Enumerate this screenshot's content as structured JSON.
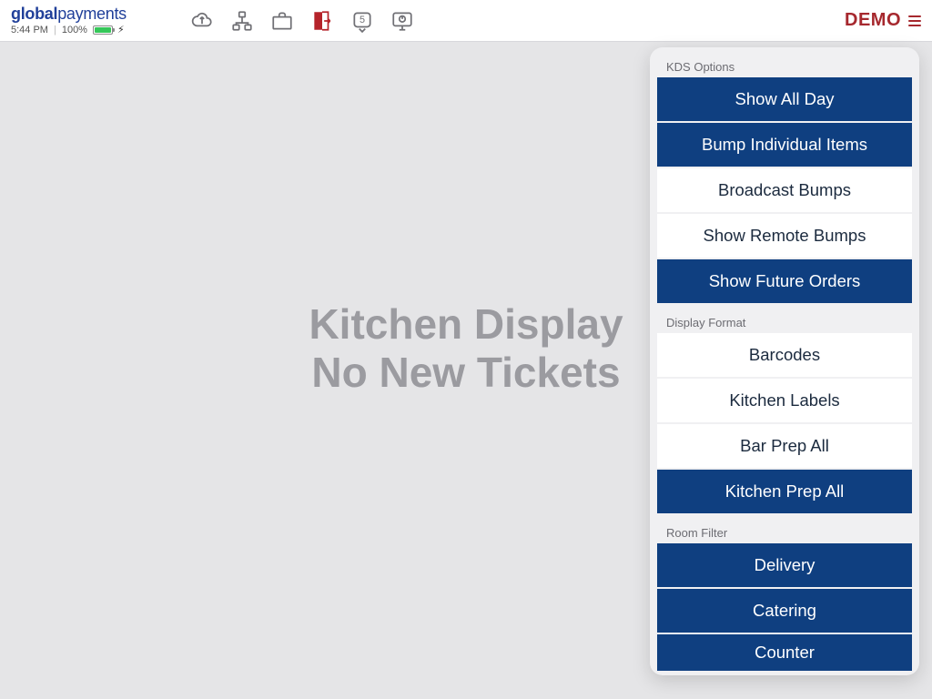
{
  "brand": {
    "bold": "global",
    "rest": "payments"
  },
  "status": {
    "time": "5:44 PM",
    "battery_percent": "100%"
  },
  "header": {
    "demo_label": "DEMO"
  },
  "main": {
    "line1": "Kitchen Display",
    "line2": "No New Tickets"
  },
  "menu": {
    "sections": [
      {
        "label": "KDS Options",
        "items": [
          {
            "label": "Show All Day",
            "selected": true
          },
          {
            "label": "Bump Individual Items",
            "selected": true
          },
          {
            "label": "Broadcast Bumps",
            "selected": false
          },
          {
            "label": "Show Remote Bumps",
            "selected": false
          },
          {
            "label": "Show Future Orders",
            "selected": true
          }
        ]
      },
      {
        "label": "Display Format",
        "items": [
          {
            "label": "Barcodes",
            "selected": false
          },
          {
            "label": "Kitchen Labels",
            "selected": false
          },
          {
            "label": "Bar Prep All",
            "selected": false
          },
          {
            "label": "Kitchen Prep All",
            "selected": true
          }
        ]
      },
      {
        "label": "Room Filter",
        "items": [
          {
            "label": "Delivery",
            "selected": true
          },
          {
            "label": "Catering",
            "selected": true
          },
          {
            "label": "Counter",
            "selected": true
          }
        ]
      }
    ]
  }
}
